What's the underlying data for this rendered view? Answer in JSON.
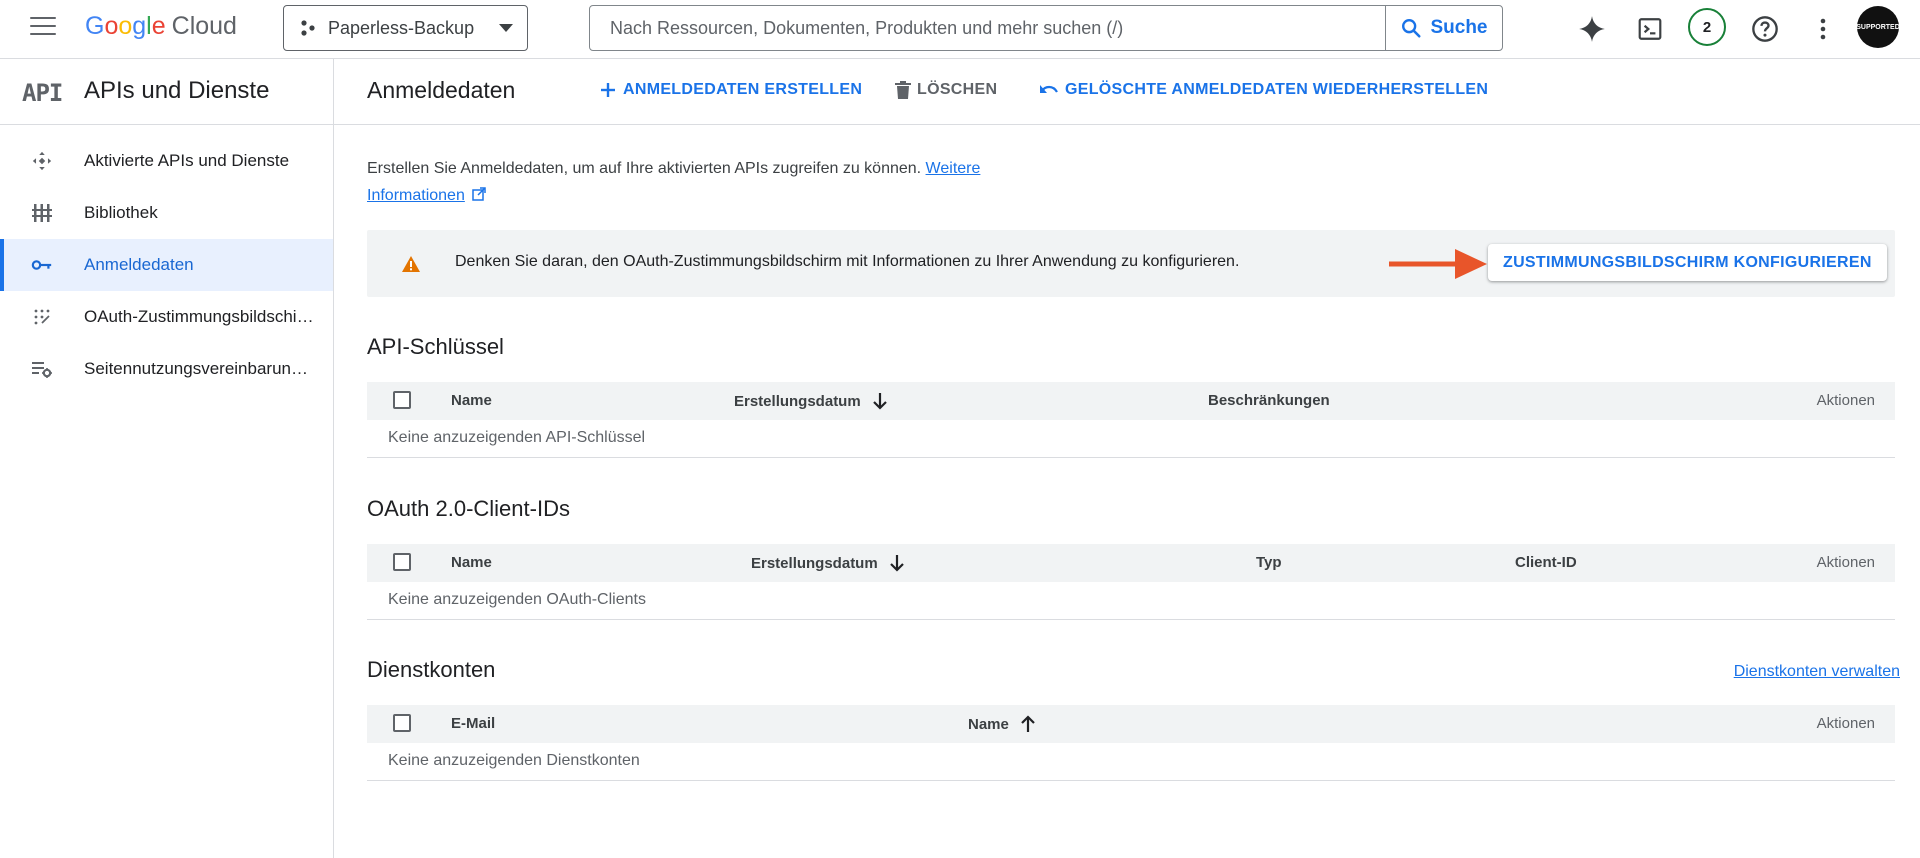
{
  "header": {
    "logo_parts": [
      "G",
      "o",
      "o",
      "g",
      "l",
      "e"
    ],
    "logo_cloud": "Cloud",
    "project": "Paperless-Backup",
    "search_placeholder": "Nach Ressourcen, Dokumenten, Produkten und mehr suchen (/)",
    "search_button": "Suche",
    "notification_count": "2",
    "avatar_text": "SUPPORTED"
  },
  "sidebar": {
    "logo": "API",
    "title": "APIs und Dienste",
    "items": [
      {
        "label": "Aktivierte APIs und Dienste",
        "icon": "apis-icon"
      },
      {
        "label": "Bibliothek",
        "icon": "library-icon"
      },
      {
        "label": "Anmeldedaten",
        "icon": "key-icon",
        "active": true
      },
      {
        "label": "OAuth-Zustimmungsbildschirm",
        "icon": "consent-icon"
      },
      {
        "label": "Seitennutzungsvereinbarungen",
        "icon": "settings-list-icon"
      }
    ]
  },
  "main": {
    "title": "Anmeldedaten",
    "actions": {
      "create": "ANMELDEDATEN ERSTELLEN",
      "delete": "LÖSCHEN",
      "restore": "GELÖSCHTE ANMELDEDATEN WIEDERHERSTELLEN"
    },
    "intro_text": "Erstellen Sie Anmeldedaten, um auf Ihre aktivierten APIs zugreifen zu können. ",
    "intro_link_1": "Weitere",
    "intro_link_2": "Informationen",
    "banner": {
      "text": "Denken Sie daran, den OAuth-Zustimmungsbildschirm mit Informationen zu Ihrer Anwendung zu konfigurieren.",
      "button": "ZUSTIMMUNGSBILDSCHIRM KONFIGURIEREN",
      "arrow_color": "#e8552a"
    },
    "api_keys": {
      "title": "API-Schlüssel",
      "columns": [
        "Name",
        "Erstellungsdatum",
        "Beschränkungen",
        "Aktionen"
      ],
      "empty": "Keine anzuzeigenden API-Schlüssel"
    },
    "oauth": {
      "title": "OAuth 2.0-Client-IDs",
      "columns": [
        "Name",
        "Erstellungsdatum",
        "Typ",
        "Client-ID",
        "Aktionen"
      ],
      "empty": "Keine anzuzeigenden OAuth-Clients"
    },
    "service_accounts": {
      "title": "Dienstkonten",
      "manage_link": "Dienstkonten verwalten",
      "columns": [
        "E-Mail",
        "Name",
        "Aktionen"
      ],
      "empty": "Keine anzuzeigenden Dienstkonten"
    }
  },
  "colors": {
    "accent": "#1a73e8",
    "active_bg": "#e8f0fe",
    "warning": "#e37400"
  }
}
